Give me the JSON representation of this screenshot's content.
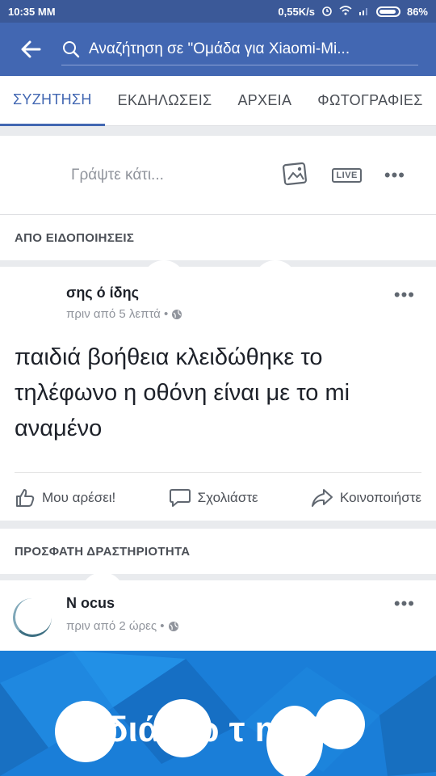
{
  "status": {
    "time": "10:35 MM",
    "speed": "0,55K/s",
    "battery": "86%"
  },
  "header": {
    "search_text": "Αναζήτηση σε \"Ομάδα για Xiaomi-Mi..."
  },
  "tabs": [
    "ΣΥΖΗΤΗΣΗ",
    "ΕΚΔΗΛΩΣΕΙΣ",
    "ΑΡΧΕΙΑ",
    "ΦΩΤΟΓΡΑΦΙΕΣ"
  ],
  "composer": {
    "placeholder": "Γράψτε κάτι...",
    "live_label": "LIVE"
  },
  "sections": {
    "notifications": "ΑΠΟ ΕΙΔΟΠΟΙΗΣΕΙΣ",
    "recent": "ΠΡΟΣΦΑΤΗ ΔΡΑΣΤΗΡΙΟΤΗΤΑ"
  },
  "post1": {
    "author": "σης        ό        ίδης",
    "meta": "πριν από 5 λεπτά •",
    "text": "παιδιά βοήθεια κλειδώθηκε το τηλέφωνο η οθόνη είναι με το mi αναμένο",
    "like": "Μου αρέσει!",
    "comment": "Σχολιάστε",
    "share": "Κοινοποιήστε"
  },
  "post2": {
    "author": "N       ocus",
    "meta": "πριν από 2 ώρες •",
    "banner_text": "  διά    χω  τ      mi 3s"
  },
  "colors": {
    "brand": "#4267b2",
    "statusbar": "#3b5998",
    "banner": "#1a7ed8"
  }
}
